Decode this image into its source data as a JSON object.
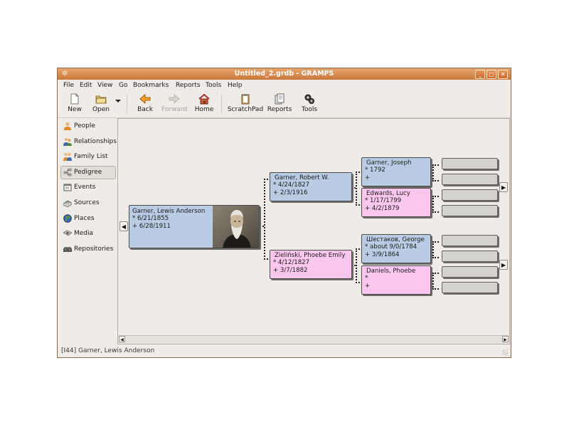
{
  "window": {
    "title": "Untitled_2.grdb - GRAMPS",
    "buttons": {
      "minimize": "_",
      "maximize": "□",
      "close": "✕"
    }
  },
  "menu": [
    "File",
    "Edit",
    "View",
    "Go",
    "Bookmarks",
    "Reports",
    "Tools",
    "Help"
  ],
  "toolbar": {
    "new": "New",
    "open": "Open",
    "back": "Back",
    "forward": "Forward",
    "home": "Home",
    "scratchpad": "ScratchPad",
    "reports": "Reports",
    "tools": "Tools"
  },
  "sidebar": [
    {
      "label": "People",
      "icon": "people-icon"
    },
    {
      "label": "Relationships",
      "icon": "relationships-icon"
    },
    {
      "label": "Family List",
      "icon": "family-list-icon"
    },
    {
      "label": "Pedigree",
      "icon": "pedigree-icon",
      "active": true
    },
    {
      "label": "Events",
      "icon": "events-icon"
    },
    {
      "label": "Sources",
      "icon": "sources-icon"
    },
    {
      "label": "Places",
      "icon": "places-icon"
    },
    {
      "label": "Media",
      "icon": "media-icon"
    },
    {
      "label": "Repositories",
      "icon": "repositories-icon"
    }
  ],
  "pedigree": {
    "root": {
      "name": "Garner, Lewis Anderson",
      "birth": "* 6/21/1855",
      "death": "+ 6/28/1911"
    },
    "father": {
      "name": "Garner, Robert W.",
      "birth": "* 4/24/1827",
      "death": "+ 2/3/1916"
    },
    "mother": {
      "name": "Zieliński, Phoebe Emily",
      "birth": "* 4/12/1827",
      "death": "+ 3/7/1882"
    },
    "ff": {
      "name": "Garner, Joseph",
      "birth": "* 1792",
      "death": "+"
    },
    "fm": {
      "name": "Edwards, Lucy",
      "birth": "* 1/17/1799",
      "death": "+ 4/2/1879"
    },
    "mf": {
      "name": "Шестаков, George",
      "birth": "* about 9/0/1784",
      "death": "+ 3/9/1864"
    },
    "mm": {
      "name": "Daniels, Phoebe",
      "birth": "*",
      "death": "+"
    }
  },
  "nav_arrows": {
    "left": "◀",
    "right": "▶"
  },
  "status": "[I44]  Garner, Lewis Anderson",
  "colors": {
    "male": "#b9cce4",
    "female": "#fcc7ef",
    "empty": "#d5d3cd",
    "titlebar": "#d48a4d"
  }
}
